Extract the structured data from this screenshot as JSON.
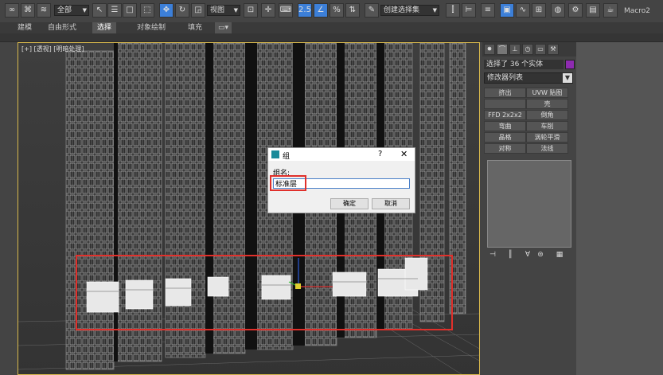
{
  "toolbar": {
    "filter_select": "全部",
    "view_select": "视图",
    "snap_value": "2.5",
    "selection_set": "创建选择集",
    "macro": "Macro2"
  },
  "ribbon": {
    "tabs": [
      "建模",
      "自由形式",
      "选择",
      "对象绘制",
      "填充"
    ]
  },
  "viewport": {
    "label": "[+] [透视] [明暗处理]"
  },
  "panel": {
    "selection_status": "选择了 36 个实体",
    "modifier_list": "修改器列表",
    "modifier_buttons": [
      "挤出",
      "UVW 贴图",
      "",
      "壳",
      "FFD 2x2x2",
      "倒角",
      "弯曲",
      "车削",
      "晶格",
      "涡轮平滑",
      "对称",
      "法线"
    ]
  },
  "dialog": {
    "title": "组",
    "help": "?",
    "close": "✕",
    "group_name_label": "组名:",
    "group_name_value": "标准层",
    "ok_label": "确定",
    "cancel_label": "取消"
  },
  "colors": {
    "accent": "#3c7fd8",
    "highlight": "#e0302b",
    "object_color": "#8e2bb0"
  }
}
